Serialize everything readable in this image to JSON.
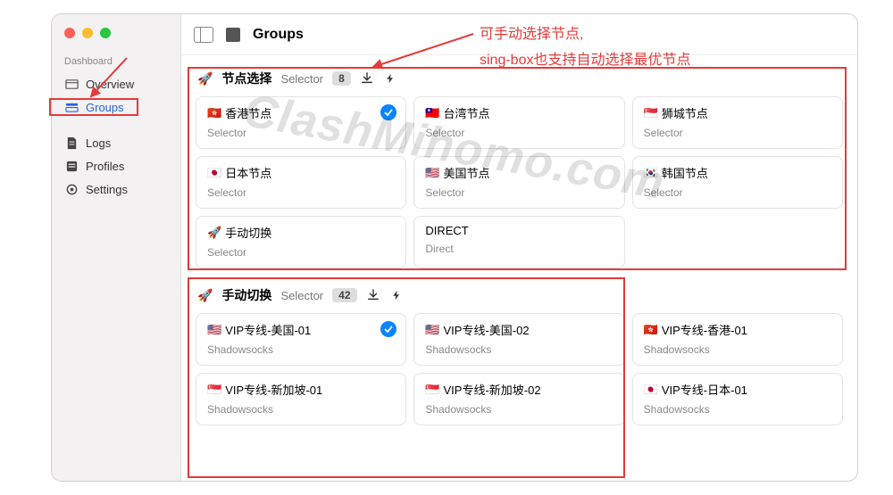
{
  "window": {
    "title": "Groups"
  },
  "sidebar": {
    "section": "Dashboard",
    "items": [
      {
        "label": "Overview",
        "icon": "overview-icon"
      },
      {
        "label": "Groups",
        "icon": "groups-icon"
      },
      {
        "label": "Logs",
        "icon": "logs-icon"
      },
      {
        "label": "Profiles",
        "icon": "profiles-icon"
      },
      {
        "label": "Settings",
        "icon": "settings-icon"
      }
    ]
  },
  "groups": [
    {
      "icon": "🚀",
      "title": "节点选择",
      "type": "Selector",
      "count": "8",
      "nodes": [
        {
          "flag": "🇭🇰",
          "name": "香港节点",
          "sub": "Selector",
          "selected": true
        },
        {
          "flag": "🇹🇼",
          "name": "台湾节点",
          "sub": "Selector",
          "selected": false
        },
        {
          "flag": "🇸🇬",
          "name": "狮城节点",
          "sub": "Selector",
          "selected": false
        },
        {
          "flag": "🇯🇵",
          "name": "日本节点",
          "sub": "Selector",
          "selected": false
        },
        {
          "flag": "🇺🇸",
          "name": "美国节点",
          "sub": "Selector",
          "selected": false
        },
        {
          "flag": "🇰🇷",
          "name": "韩国节点",
          "sub": "Selector",
          "selected": false
        },
        {
          "flag": "🚀",
          "name": "手动切换",
          "sub": "Selector",
          "selected": false
        },
        {
          "flag": "",
          "name": "DIRECT",
          "sub": "Direct",
          "selected": false
        }
      ]
    },
    {
      "icon": "🚀",
      "title": "手动切换",
      "type": "Selector",
      "count": "42",
      "nodes": [
        {
          "flag": "🇺🇸",
          "name": "VIP专线-美国-01",
          "sub": "Shadowsocks",
          "selected": true
        },
        {
          "flag": "🇺🇸",
          "name": "VIP专线-美国-02",
          "sub": "Shadowsocks",
          "selected": false
        },
        {
          "flag": "🇭🇰",
          "name": "VIP专线-香港-01",
          "sub": "Shadowsocks",
          "selected": false
        },
        {
          "flag": "🇸🇬",
          "name": "VIP专线-新加坡-01",
          "sub": "Shadowsocks",
          "selected": false
        },
        {
          "flag": "🇸🇬",
          "name": "VIP专线-新加坡-02",
          "sub": "Shadowsocks",
          "selected": false
        },
        {
          "flag": "🇯🇵",
          "name": "VIP专线-日本-01",
          "sub": "Shadowsocks",
          "selected": false
        }
      ]
    }
  ],
  "annotations": {
    "text_line1": "可手动选择节点,",
    "text_line2": "sing-box也支持自动选择最优节点"
  },
  "watermark": "ClashMihomo.com"
}
